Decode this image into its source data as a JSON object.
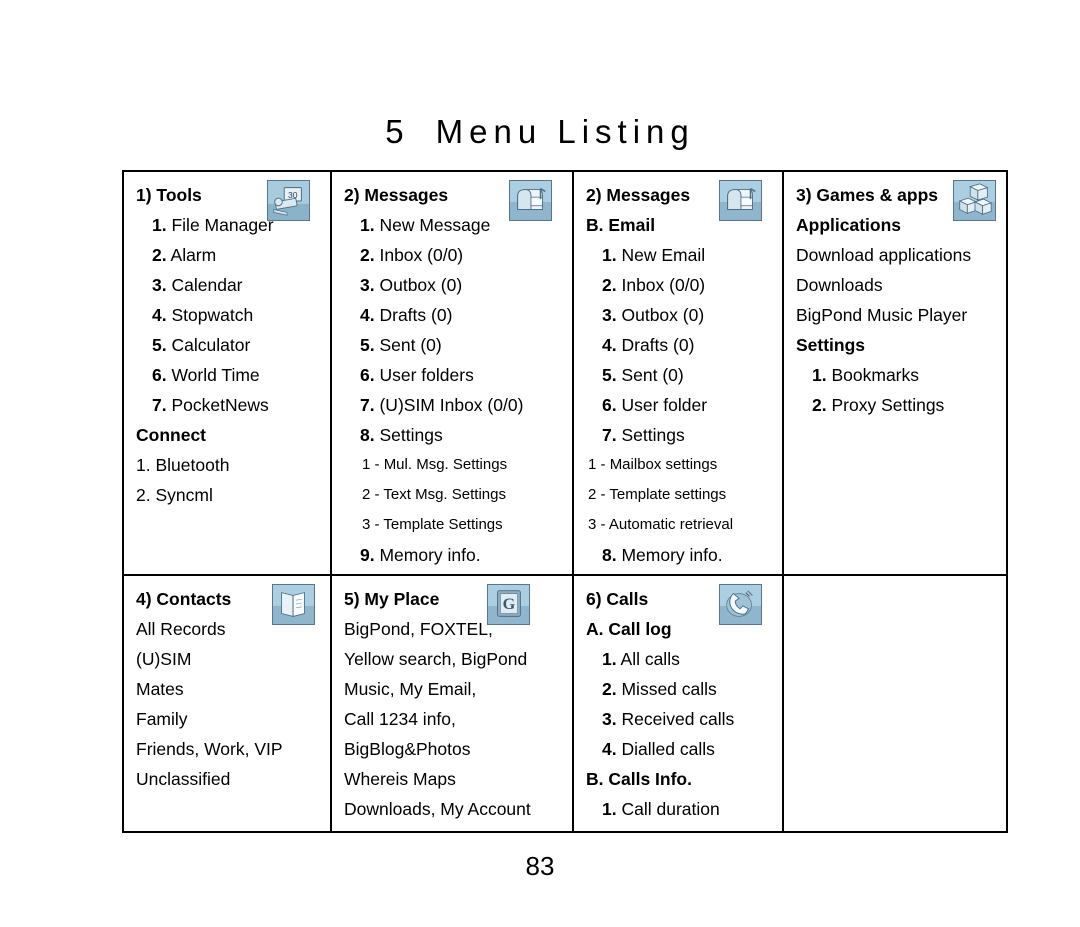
{
  "document": {
    "chapter_number": "5",
    "title": "Menu Listing",
    "page_number": "83"
  },
  "table": {
    "row_top": [
      {
        "id": "tools",
        "header": "1) Tools",
        "icon": "tools-icon",
        "entries": [
          {
            "kind": "item",
            "num": "1.",
            "label": "File Manager"
          },
          {
            "kind": "item",
            "num": "2.",
            "label": "Alarm"
          },
          {
            "kind": "item",
            "num": "3.",
            "label": "Calendar"
          },
          {
            "kind": "item",
            "num": "4.",
            "label": "Stopwatch"
          },
          {
            "kind": "item",
            "num": "5.",
            "label": "Calculator"
          },
          {
            "kind": "item",
            "num": "6.",
            "label": "World Time"
          },
          {
            "kind": "item",
            "num": "7.",
            "label": "PocketNews"
          },
          {
            "kind": "subhdr",
            "label": "Connect"
          },
          {
            "kind": "plainitem",
            "num": "1.",
            "label": "Bluetooth"
          },
          {
            "kind": "plainitem",
            "num": "2.",
            "label": "Syncml"
          }
        ]
      },
      {
        "id": "messages",
        "header": "2) Messages",
        "icon": "mailbox-icon",
        "entries": [
          {
            "kind": "item",
            "num": "1.",
            "label": "New Message"
          },
          {
            "kind": "item",
            "num": "2.",
            "label": "Inbox (0/0)"
          },
          {
            "kind": "item",
            "num": "3.",
            "label": "Outbox (0)"
          },
          {
            "kind": "item",
            "num": "4.",
            "label": "Drafts (0)"
          },
          {
            "kind": "item",
            "num": "5.",
            "label": "Sent (0)"
          },
          {
            "kind": "item",
            "num": "6.",
            "label": "User folders"
          },
          {
            "kind": "item",
            "num": "7.",
            "label": "(U)SIM Inbox (0/0)"
          },
          {
            "kind": "item",
            "num": "8.",
            "label": "Settings"
          },
          {
            "kind": "subitem",
            "num": "1 -",
            "label": "Mul. Msg. Settings"
          },
          {
            "kind": "subitem",
            "num": "2 -",
            "label": "Text Msg. Settings"
          },
          {
            "kind": "subitem",
            "num": "3 -",
            "label": "Template Settings"
          },
          {
            "kind": "item",
            "num": "9.",
            "label": " Memory info."
          }
        ]
      },
      {
        "id": "messages-email",
        "header": "2) Messages",
        "subheader": "B. Email",
        "icon": "mailbox-icon",
        "entries": [
          {
            "kind": "item",
            "num": "1.",
            "label": "New Email"
          },
          {
            "kind": "item",
            "num": "2.",
            "label": "Inbox (0/0)"
          },
          {
            "kind": "item",
            "num": "3.",
            "label": "Outbox (0)"
          },
          {
            "kind": "item",
            "num": "4.",
            "label": "Drafts (0)"
          },
          {
            "kind": "item",
            "num": "5.",
            "label": "Sent (0)"
          },
          {
            "kind": "item",
            "num": "6.",
            "label": "User folder"
          },
          {
            "kind": "item",
            "num": "7.",
            "label": "Settings"
          },
          {
            "kind": "subitem",
            "num": "1 -",
            "label": "Mailbox settings"
          },
          {
            "kind": "subitem",
            "num": "2 -",
            "label": "Template settings"
          },
          {
            "kind": "subitem",
            "num": "3 -",
            "label": "Automatic retrieval"
          },
          {
            "kind": "item",
            "num": "8.",
            "label": "Memory info."
          }
        ]
      },
      {
        "id": "games-apps",
        "header": "3) Games & apps",
        "icon": "blocks-icon",
        "entries": [
          {
            "kind": "subhdr",
            "label": "Applications"
          },
          {
            "kind": "plain",
            "label": "Download applications"
          },
          {
            "kind": "plain",
            "label": "Downloads"
          },
          {
            "kind": "plain",
            "label": "BigPond Music Player"
          },
          {
            "kind": "subhdr",
            "label": "Settings"
          },
          {
            "kind": "item",
            "num": "1.",
            "label": "Bookmarks"
          },
          {
            "kind": "item",
            "num": "2.",
            "label": "Proxy Settings"
          }
        ]
      }
    ],
    "row_bottom": [
      {
        "id": "contacts",
        "header": "4) Contacts",
        "icon": "address-book-icon",
        "entries": [
          {
            "kind": "plain",
            "label": "All Records"
          },
          {
            "kind": "plain",
            "label": "(U)SIM"
          },
          {
            "kind": "plain",
            "label": "Mates"
          },
          {
            "kind": "plain",
            "label": "Family"
          },
          {
            "kind": "plain",
            "label": "Friends, Work, VIP"
          },
          {
            "kind": "plain",
            "label": "Unclassified"
          }
        ]
      },
      {
        "id": "my-place",
        "header": "5) My Place",
        "icon": "portal-g-icon",
        "entries": [
          {
            "kind": "plain",
            "label": "BigPond, FOXTEL,"
          },
          {
            "kind": "plain",
            "label": "Yellow search, BigPond"
          },
          {
            "kind": "plain",
            "label": "Music, My Email,"
          },
          {
            "kind": "plain",
            "label": "Call 1234 info,"
          },
          {
            "kind": "plain",
            "label": "BigBlog&Photos"
          },
          {
            "kind": "plain",
            "label": "Whereis Maps"
          },
          {
            "kind": "plain",
            "label": "Downloads, My Account"
          }
        ]
      },
      {
        "id": "calls",
        "header": "6) Calls",
        "subheader": "A. Call log",
        "icon": "handset-icon",
        "entries": [
          {
            "kind": "item",
            "num": "1.",
            "label": "All calls"
          },
          {
            "kind": "item",
            "num": "2.",
            "label": "Missed calls"
          },
          {
            "kind": "item",
            "num": "3.",
            "label": "Received calls"
          },
          {
            "kind": "item",
            "num": "4.",
            "label": "Dialled calls"
          },
          {
            "kind": "subhdr",
            "label": "B. Calls Info."
          },
          {
            "kind": "item",
            "num": "1.",
            "label": "Call duration"
          }
        ]
      },
      {
        "id": "empty",
        "header": "",
        "entries": []
      }
    ]
  }
}
